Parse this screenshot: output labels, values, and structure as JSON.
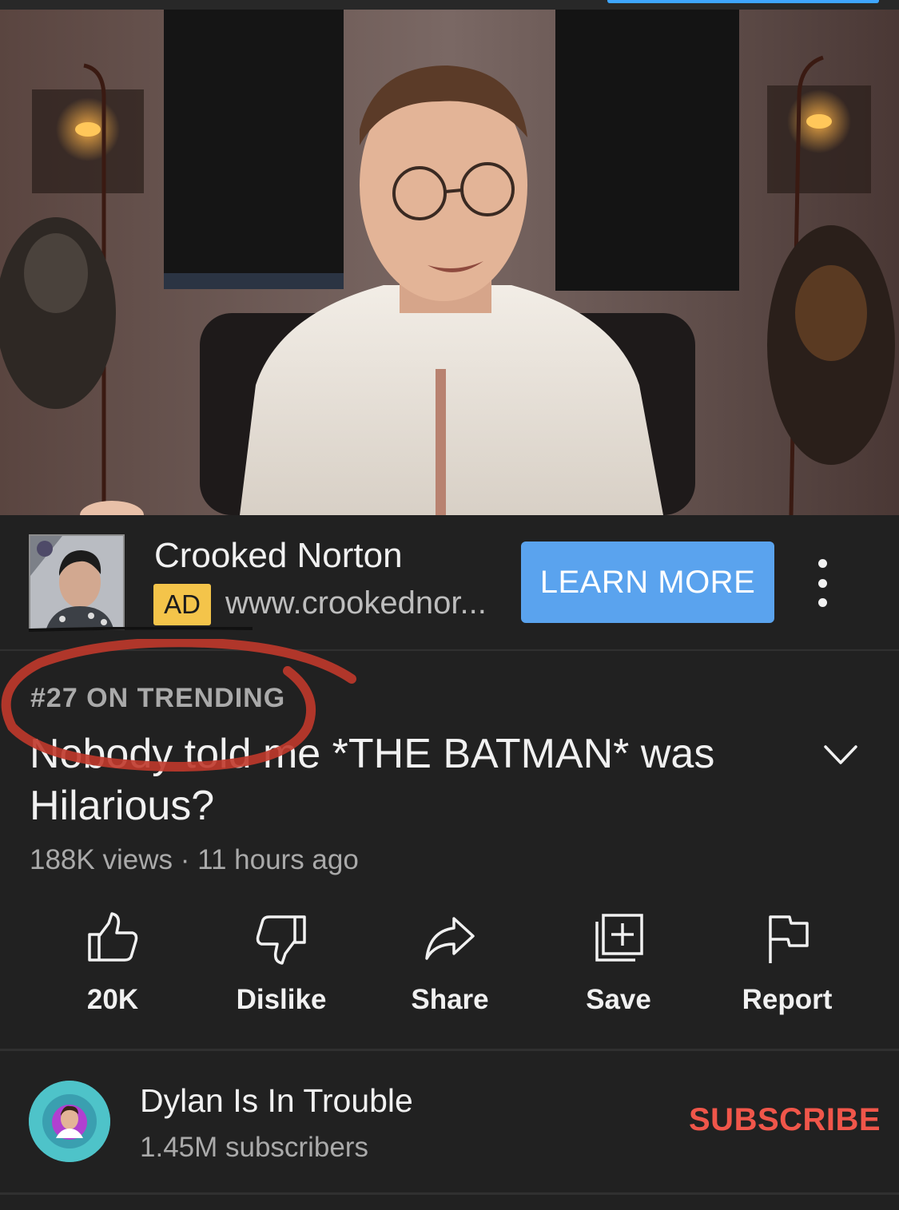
{
  "ad": {
    "advertiser": "Crooked Norton",
    "badge": "AD",
    "url": "www.crookednor...",
    "cta": "LEARN MORE"
  },
  "video": {
    "trending": "#27 ON TRENDING",
    "title": "Nobody told me *THE BATMAN* was Hilarious?",
    "meta": "188K views · 11 hours ago"
  },
  "actions": [
    {
      "label": "20K",
      "icon": "thumbs-up-icon"
    },
    {
      "label": "Dislike",
      "icon": "thumbs-down-icon"
    },
    {
      "label": "Share",
      "icon": "share-arrow-icon"
    },
    {
      "label": "Save",
      "icon": "add-to-playlist-icon"
    },
    {
      "label": "Report",
      "icon": "flag-icon"
    }
  ],
  "channel": {
    "name": "Dylan Is In Trouble",
    "subscribers": "1.45M subscribers",
    "subscribe_label": "SUBSCRIBE"
  },
  "colors": {
    "background": "#212121",
    "cta_blue": "#5aa3ee",
    "badge_yellow": "#f4c44a",
    "subscribe_red": "#f0564a",
    "annotation_red": "#c0392b"
  }
}
